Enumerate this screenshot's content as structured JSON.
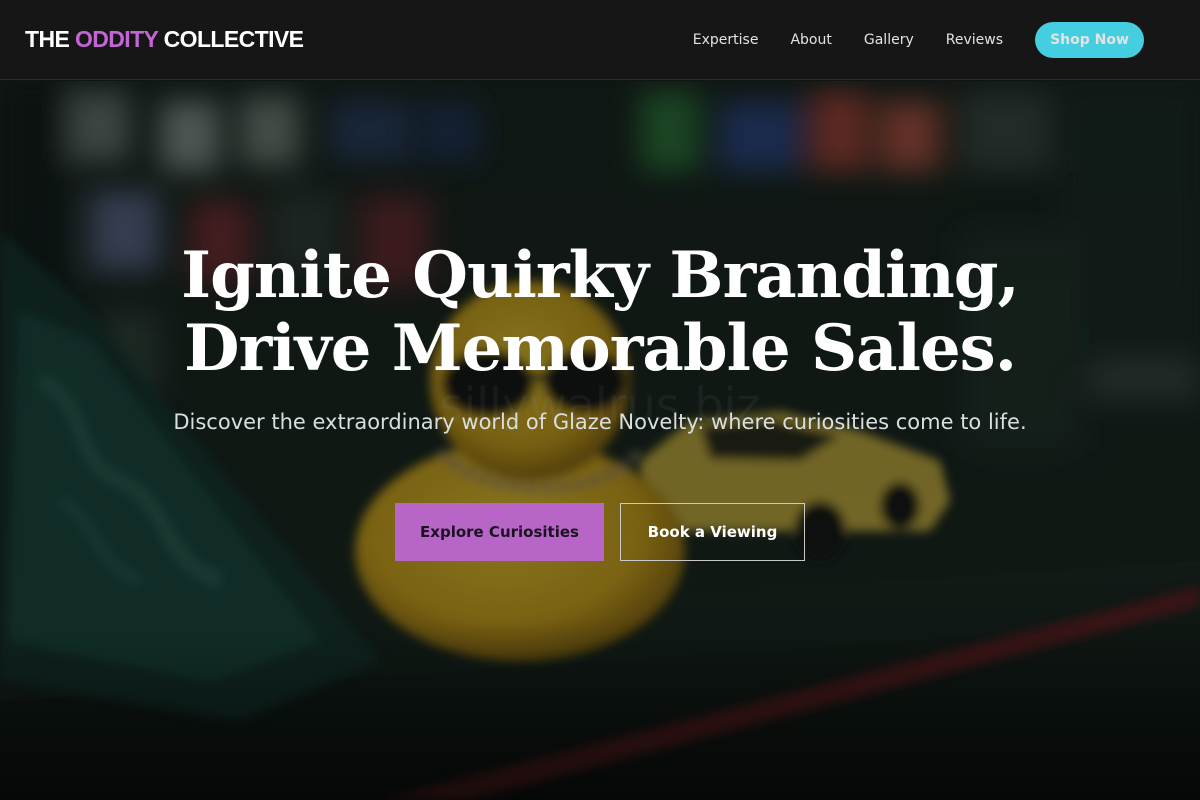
{
  "header": {
    "logo": {
      "part1": "THE ",
      "accent": "ODDITY",
      "part2": " COLLECTIVE"
    },
    "nav": [
      {
        "label": "Expertise"
      },
      {
        "label": "About"
      },
      {
        "label": "Gallery"
      },
      {
        "label": "Reviews"
      }
    ],
    "cta_label": "Shop Now"
  },
  "hero": {
    "headline_line1": "Ignite Quirky Branding,",
    "headline_line2": "Drive Memorable Sales.",
    "subtitle": "Discover the extraordinary world of Glaze Novelty: where curiosities come to life.",
    "primary_cta": "Explore Curiosities",
    "secondary_cta": "Book a Viewing",
    "watermark": "sillywalrus.biz"
  },
  "colors": {
    "accent_purple": "#c266d3",
    "cta_purple": "#b865c8",
    "shop_cyan": "#45cde0",
    "header_bg": "#161616"
  }
}
